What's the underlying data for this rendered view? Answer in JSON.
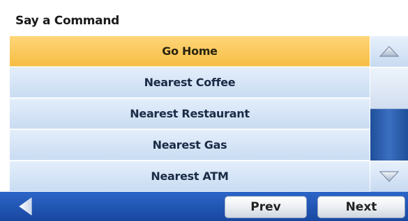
{
  "header": {
    "title": "Say a Command"
  },
  "commands": [
    {
      "label": "Go Home",
      "selected": true
    },
    {
      "label": "Nearest Coffee",
      "selected": false
    },
    {
      "label": "Nearest Restaurant",
      "selected": false
    },
    {
      "label": "Nearest Gas",
      "selected": false
    },
    {
      "label": "Nearest ATM",
      "selected": false
    }
  ],
  "scrollbar": {
    "up_icon": "triangle-up-icon",
    "down_icon": "triangle-down-icon"
  },
  "footer": {
    "back_icon": "back-arrow-icon",
    "prev_label": "Prev",
    "next_label": "Next"
  },
  "colors": {
    "selected_row": "#f6bd43",
    "row": "#d6e5f6",
    "footer": "#1f55b4",
    "scroll_track": "#2a5cab"
  }
}
